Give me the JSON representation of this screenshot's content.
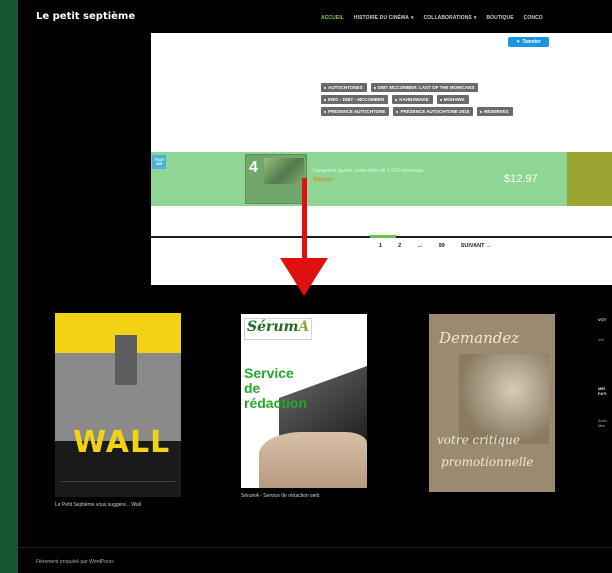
{
  "site_title": "Le petit septième",
  "nav": [
    {
      "label": "ACCUEIL",
      "active": true,
      "caret": false
    },
    {
      "label": "HISTOIRE DU CINÉMA",
      "active": false,
      "caret": true
    },
    {
      "label": "COLLABORATIONS",
      "active": false,
      "caret": true
    },
    {
      "label": "BOUTIQUE",
      "active": false,
      "caret": false
    },
    {
      "label": "CONCO",
      "active": false,
      "caret": false
    }
  ],
  "tweet_button": {
    "label": "Tweeter"
  },
  "tags": [
    [
      "AUTOCHTONES",
      "DIBT MCCOMBER: LAST OF THE MOHICANS"
    ],
    [
      "ERIC - DIBT - MCCOMBER",
      "KAHNAWAKE",
      "MOHAWK"
    ],
    [
      "PRÉSENCE AUTOCHTONE",
      "PRÉSENCE AUTOCHTONE 2018",
      "RÉSERVES"
    ]
  ],
  "ad": {
    "badge": "TECH AIR",
    "puzzle_number": "4",
    "description": "Comprend quatre casse-têtes de 1 000 morceaux",
    "brand": "Walmart",
    "price": "$12.97"
  },
  "pagination": [
    "1",
    "2",
    "…",
    "99",
    "SUIVANT →"
  ],
  "posters": [
    {
      "title": "WALL",
      "caption": "Le Petit Septième vous suggère... Wall"
    },
    {
      "logo": "Sérum",
      "logo_accent": "A",
      "text": [
        "Service",
        "de",
        "rédaction"
      ],
      "caption": "SérumA - Service de rédaction web"
    },
    {
      "text": [
        "Demandez",
        "votre critique",
        "promotionnelle"
      ],
      "caption": ""
    }
  ],
  "sidebar": [
    {
      "title": "VOT",
      "text": "Vot"
    },
    {
      "title": "MÉI PATI",
      "text": "Avec Mar"
    }
  ],
  "footer": "Fièrement propulsé par WordPress",
  "colors": {
    "accent_green": "#7fd34a",
    "arrow_red": "#e01010",
    "price_green": "#8fd694"
  }
}
